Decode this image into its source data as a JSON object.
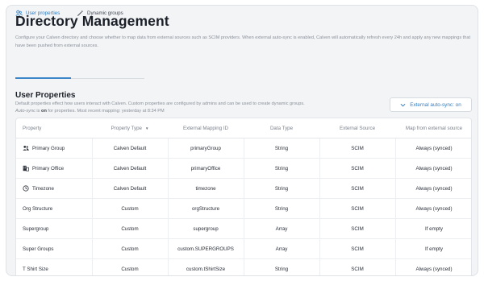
{
  "page": {
    "title": "Directory Management",
    "description": "Configure your Calven directory and choose whether to map data from external sources such as SCIM providers. When external auto-sync is enabled, Calven will automatically refresh every 24h and apply any new mappings that have been pushed from external sources."
  },
  "tabs": [
    {
      "label": "User properties",
      "icon": "users-icon",
      "active": true
    },
    {
      "label": "Dynamic groups",
      "icon": "magic-wand-icon",
      "active": false
    }
  ],
  "section": {
    "title": "User Properties",
    "desc_line1": "Default properties effect how users interact with Calven. Custom properties are configured by admins and can be used to create dynamic groups.",
    "desc_autosync": "Auto-sync",
    "desc_is": " is ",
    "desc_on": "on",
    "desc_rest": " for properties. Most recent mapping: yesterday at 8:34 PM",
    "sync_button": "External auto-sync: on"
  },
  "table": {
    "headers": [
      "Property",
      "Property Type",
      "External Mapping ID",
      "Data Type",
      "External Source",
      "Map from external source"
    ],
    "rows": [
      {
        "property": "Primary Group",
        "icon": "people-icon",
        "type": "Calven Default",
        "mapping": "primaryGroup",
        "data_type": "String",
        "source": "SCIM",
        "map": "Always (synced)"
      },
      {
        "property": "Primary Office",
        "icon": "office-building-icon",
        "type": "Calven Default",
        "mapping": "primaryOffice",
        "data_type": "String",
        "source": "SCIM",
        "map": "Always (synced)"
      },
      {
        "property": "Timezone",
        "icon": "clock-icon",
        "type": "Calven Default",
        "mapping": "timezone",
        "data_type": "String",
        "source": "SCIM",
        "map": "Always (synced)"
      },
      {
        "property": "Org Structure",
        "icon": "",
        "type": "Custom",
        "mapping": "orgStructure",
        "data_type": "String",
        "source": "SCIM",
        "map": "Always (synced)"
      },
      {
        "property": "Supergroup",
        "icon": "",
        "type": "Custom",
        "mapping": "supergroup",
        "data_type": "Array",
        "source": "SCIM",
        "map": "If empty"
      },
      {
        "property": "Super Groups",
        "icon": "",
        "type": "Custom",
        "mapping": "custom.SUPERGROUPS",
        "data_type": "Array",
        "source": "SCIM",
        "map": "If empty"
      },
      {
        "property": "T Shirt Size",
        "icon": "",
        "type": "Custom",
        "mapping": "custom.tShirtSize",
        "data_type": "String",
        "source": "SCIM",
        "map": "Always (synced)"
      }
    ]
  },
  "colors": {
    "accent": "#2f7ec4",
    "background": "#f3f4f6"
  }
}
